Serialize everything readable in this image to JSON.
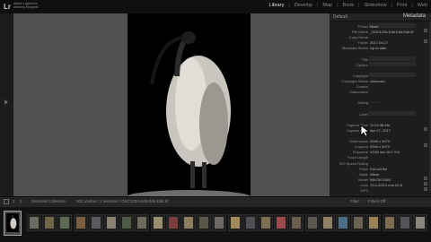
{
  "app": {
    "logo": "Lr",
    "brand_line1": "Adobe Lightroom",
    "brand_line2": "Anthony Morganti"
  },
  "modules": [
    "Library",
    "|",
    "Develop",
    "|",
    "Map",
    "|",
    "Book",
    "|",
    "Slideshow",
    "|",
    "Print",
    "|",
    "Web"
  ],
  "right_panel": {
    "preset_label": "Default",
    "title": "Metadata",
    "rows": [
      {
        "label": "Preset",
        "value": "None",
        "field": true,
        "button": false
      },
      {
        "label": "File Name",
        "value": "_DSC1234-Edit-Edit-Edit.tif",
        "field": false,
        "button": true
      },
      {
        "label": "Copy Name",
        "value": "",
        "field": false,
        "button": false
      },
      {
        "label": "Folder",
        "value": "2017-04-27",
        "field": false,
        "button": true
      },
      {
        "label": "Metadata Status",
        "value": "Up to date",
        "field": false,
        "button": false
      },
      {
        "label": "",
        "value": "",
        "field": false,
        "button": false
      },
      {
        "label": "Title",
        "value": "",
        "field": true,
        "button": false
      },
      {
        "label": "Caption",
        "value": "",
        "field": true,
        "button": false
      },
      {
        "label": "",
        "value": "",
        "field": false,
        "button": false
      },
      {
        "label": "Copyright",
        "value": "",
        "field": true,
        "button": false
      },
      {
        "label": "Copyright Status",
        "value": "Unknown",
        "field": false,
        "button": false
      },
      {
        "label": "Creator",
        "value": "",
        "field": false,
        "button": false
      },
      {
        "label": "Sublocation",
        "value": "",
        "field": false,
        "button": false
      },
      {
        "label": "",
        "value": "",
        "field": false,
        "button": false
      },
      {
        "label": "Rating",
        "value": "· · · · ·",
        "field": false,
        "button": false
      },
      {
        "label": "",
        "value": "",
        "field": false,
        "button": false
      },
      {
        "label": "Label",
        "value": "",
        "field": true,
        "button": false
      },
      {
        "label": "",
        "value": "",
        "field": false,
        "button": false
      },
      {
        "label": "Capture Time",
        "value": "11:04:38 AM",
        "field": false,
        "button": false
      },
      {
        "label": "Capture Date",
        "value": "Apr 27, 2017",
        "field": false,
        "button": true
      },
      {
        "label": "",
        "value": "",
        "field": false,
        "button": false
      },
      {
        "label": "Dimensions",
        "value": "2049 x 3073",
        "field": false,
        "button": false
      },
      {
        "label": "Cropped",
        "value": "2049 x 3073",
        "field": false,
        "button": true
      },
      {
        "label": "Exposure",
        "value": "1/160 sec at f / 5.6",
        "field": false,
        "button": false
      },
      {
        "label": "Focal Length",
        "value": "",
        "field": false,
        "button": false
      },
      {
        "label": "ISO Speed Rating",
        "value": "",
        "field": false,
        "button": false
      },
      {
        "label": "Flash",
        "value": "Did not fire",
        "field": false,
        "button": false
      },
      {
        "label": "Make",
        "value": "Nikon",
        "field": false,
        "button": false
      },
      {
        "label": "Model",
        "value": "NIKON D500",
        "field": false,
        "button": true
      },
      {
        "label": "Lens",
        "value": "70.0-200.0 mm f/2.8",
        "field": false,
        "button": true
      },
      {
        "label": "GPS",
        "value": "",
        "field": false,
        "button": true
      }
    ]
  },
  "toolbar": {
    "page_1": "1",
    "page_2": "2",
    "source_text": "Selected Collection",
    "count_text": "302 photos / 1 selected / DSC1234-Edit-Edit-Edit.tif",
    "filter_label": "Filter :",
    "filter_value": "Filters Off"
  },
  "filmstrip": {
    "thumb_colors": [
      "#6b6b62",
      "#6f6547",
      "#5f6a55",
      "#7a5f3f",
      "#5a5a62",
      "#8a8173",
      "#4d5a45",
      "#6c6a5c",
      "#9a8f70",
      "#7a3d3d",
      "#8c7e5e",
      "#5b5648",
      "#6e6a63",
      "#a08a5c",
      "#4f4f55",
      "#7d6e55",
      "#9b4b4b",
      "#6d5d4f",
      "#5c574f",
      "#8f8166",
      "#4e6e86",
      "#6b6352",
      "#9a8155",
      "#7e6c52",
      "#55525a",
      "#8c8579"
    ]
  },
  "colors": {
    "background": "#505050",
    "panel": "#1d1d1d",
    "accent_active": "#e2e2e2"
  }
}
